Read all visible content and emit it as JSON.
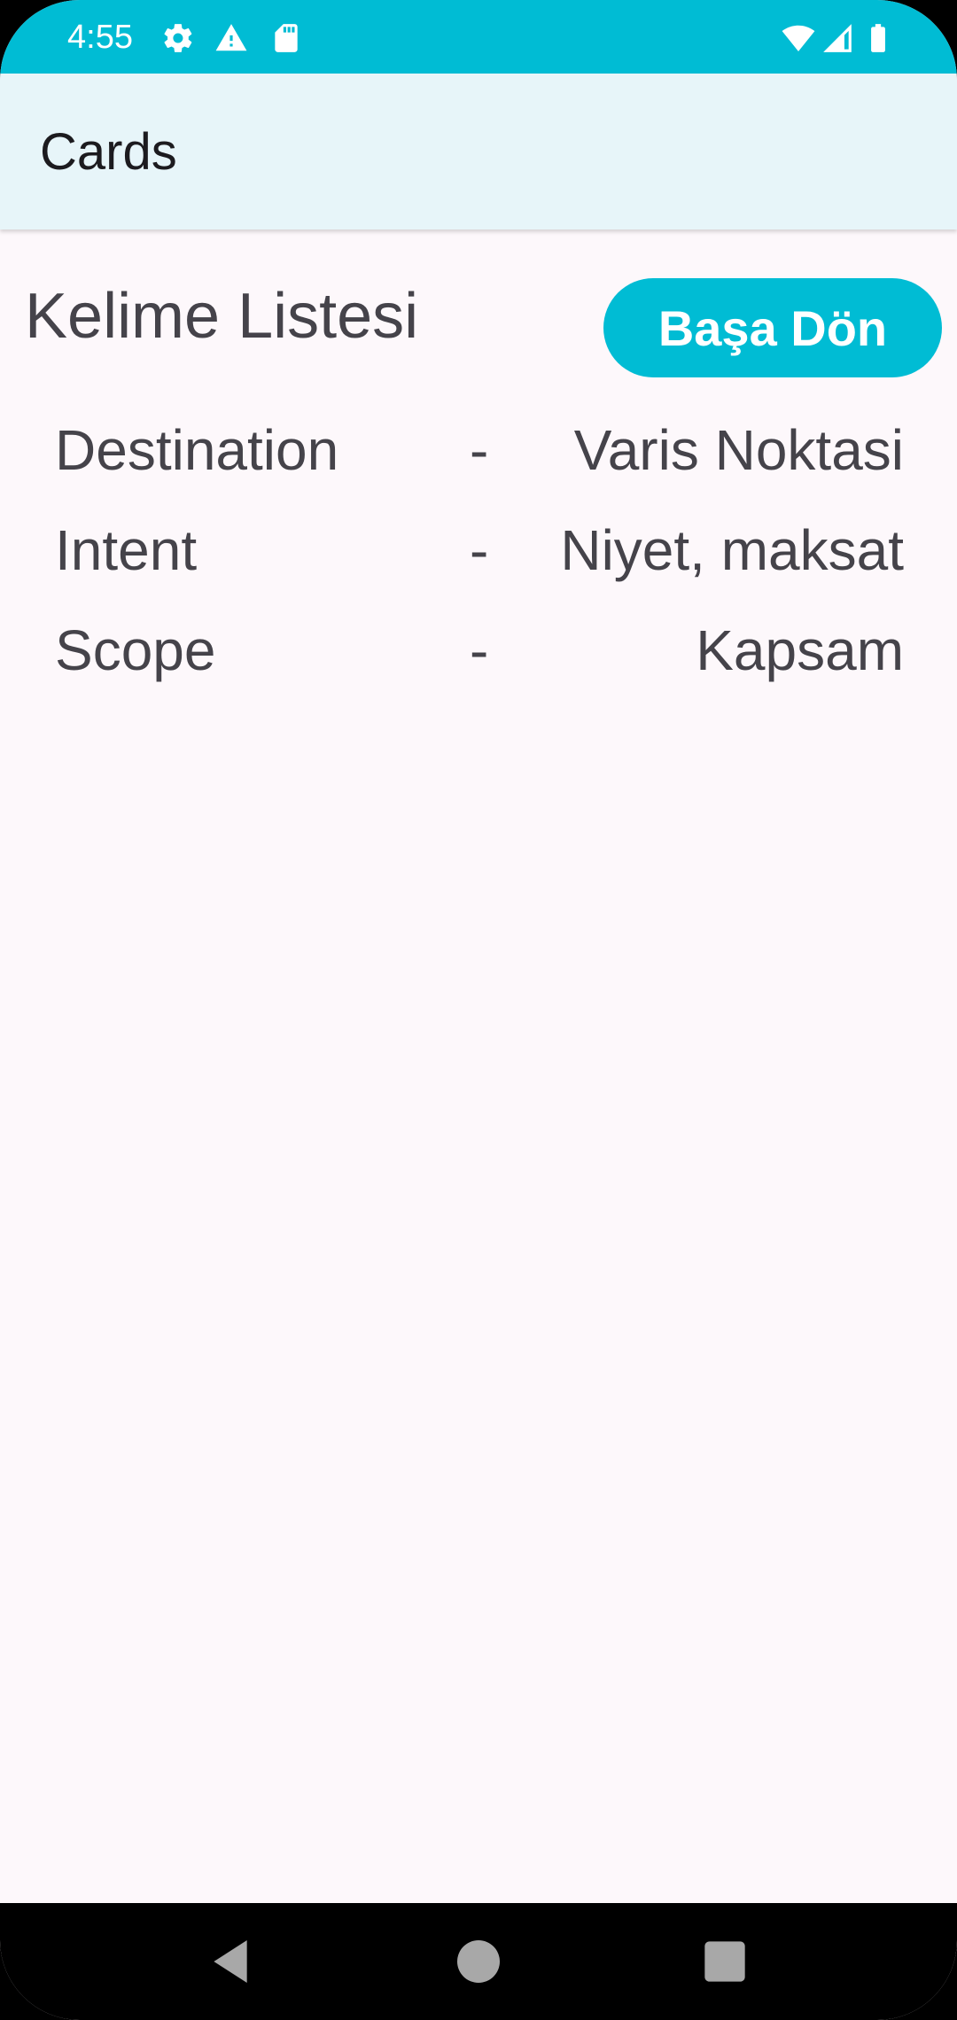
{
  "status_bar": {
    "time": "4:55",
    "left_icons": [
      "gear-icon",
      "warning-icon",
      "sd-card-icon"
    ],
    "right_icons": [
      "wifi-icon",
      "cell-signal-icon",
      "battery-icon"
    ],
    "background": "#00bcd4"
  },
  "app_bar": {
    "title": "Cards",
    "background": "#e7f5f9"
  },
  "content": {
    "heading": "Kelime Listesi",
    "back_button_label": "Başa Dön",
    "accent": "#00bcd4",
    "words": [
      {
        "english": "Destination",
        "separator": "-",
        "turkish": "Varis Noktasi"
      },
      {
        "english": "Intent",
        "separator": "-",
        "turkish": "Niyet, maksat"
      },
      {
        "english": "Scope",
        "separator": "-",
        "turkish": "Kapsam"
      }
    ]
  },
  "nav_bar": {
    "buttons": [
      "back-triangle-icon",
      "home-circle-icon",
      "recents-square-icon"
    ]
  }
}
